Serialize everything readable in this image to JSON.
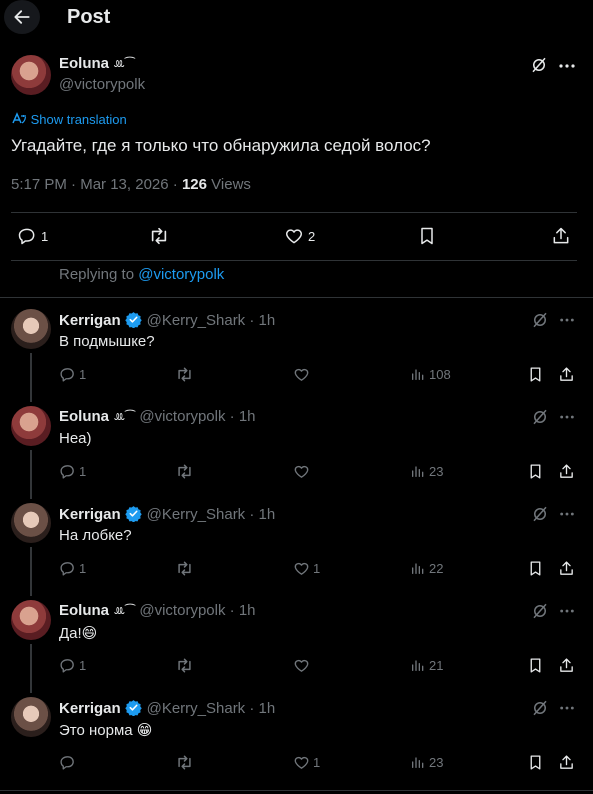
{
  "header": {
    "title": "Post"
  },
  "main_post": {
    "author_name": "Eoluna",
    "author_handle": "@victorypolk",
    "translate_label": "Show translation",
    "text": "Угадайте, где я только что обнаружила седой волос?",
    "time": "5:17 PM",
    "date": "Mar 13, 2026",
    "views_count": "126",
    "views_label": "Views",
    "reply_count": "1",
    "like_count": "2"
  },
  "replying_to": {
    "label": "Replying to",
    "handle": "@victorypolk"
  },
  "replies": [
    {
      "name": "Kerrigan",
      "handle": "@Kerry_Shark",
      "time": "1h",
      "text": "В подмышке?",
      "reply_count": "1",
      "retweet_count": "",
      "like_count": "",
      "views": "108",
      "verified": true
    },
    {
      "name": "Eoluna",
      "handle": "@victorypolk",
      "time": "1h",
      "text": "Неа)",
      "reply_count": "1",
      "retweet_count": "",
      "like_count": "",
      "views": "23",
      "verified": false
    },
    {
      "name": "Kerrigan",
      "handle": "@Kerry_Shark",
      "time": "1h",
      "text": "На лобке?",
      "reply_count": "1",
      "retweet_count": "",
      "like_count": "1",
      "views": "22",
      "verified": true
    },
    {
      "name": "Eoluna",
      "handle": "@victorypolk",
      "time": "1h",
      "text": "Да!😄",
      "reply_count": "1",
      "retweet_count": "",
      "like_count": "",
      "views": "21",
      "verified": false
    },
    {
      "name": "Kerrigan",
      "handle": "@Kerry_Shark",
      "time": "1h",
      "text": "Это норма 😁",
      "reply_count": "",
      "retweet_count": "",
      "like_count": "1",
      "views": "23",
      "verified": true
    }
  ],
  "icons": {
    "back": "arrow-left-icon",
    "more": "more-icon",
    "grok": "grok-icon",
    "reply": "reply-icon",
    "retweet": "retweet-icon",
    "like": "heart-icon",
    "views": "views-icon",
    "bookmark": "bookmark-icon",
    "share": "share-icon",
    "translate": "translate-icon",
    "verified": "verified-badge-icon"
  },
  "colors": {
    "background": "#000000",
    "text": "#e7e9ea",
    "muted": "#71767b",
    "accent": "#1d9bf0",
    "divider": "#2f3336"
  }
}
